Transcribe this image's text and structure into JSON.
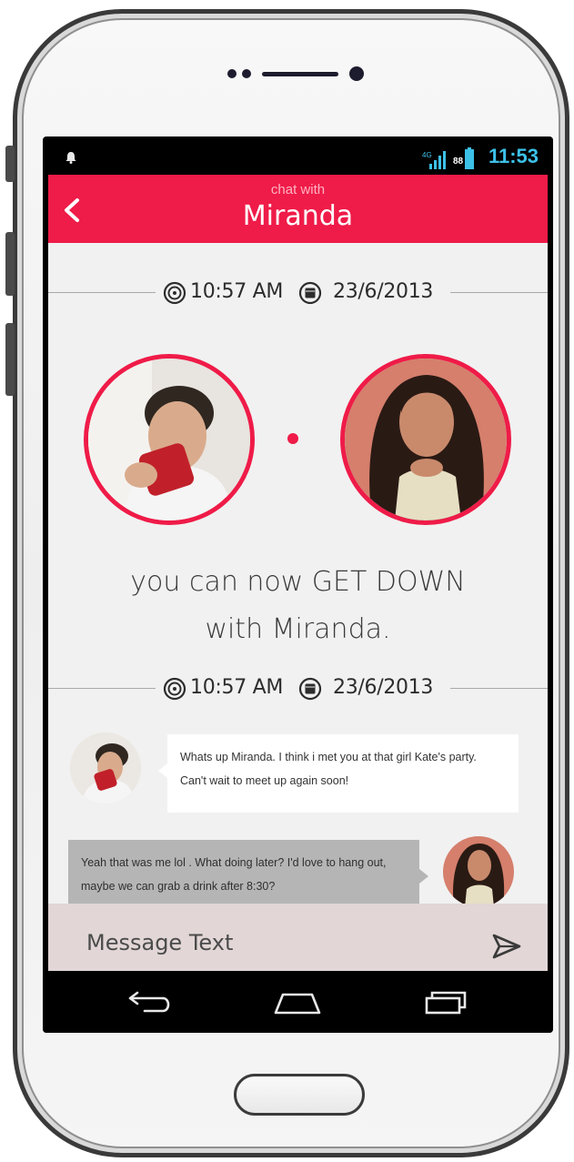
{
  "status_bar": {
    "time": "11:53",
    "network": "4G",
    "battery": "88"
  },
  "header": {
    "subtitle": "chat with",
    "title": "Miranda"
  },
  "match_timestamp": {
    "time": "10:57 AM",
    "date": "23/6/2013"
  },
  "match_message": {
    "line1": "you can now GET DOWN",
    "line2": "with Miranda."
  },
  "chat_timestamp": {
    "time": "10:57 AM",
    "date": "23/6/2013"
  },
  "messages": [
    {
      "from": "user",
      "text": "Whats up Miranda. I think i met you at that girl Kate's party. Can't wait to meet up again soon!"
    },
    {
      "from": "miranda",
      "text": "Yeah that was me lol . What doing later? I'd love to hang out, maybe we can grab a drink after 8:30?"
    }
  ],
  "composer": {
    "placeholder": "Message Text"
  },
  "colors": {
    "accent": "#ef1b48",
    "status_time": "#3cc1e8",
    "screen_bg": "#f1f1f1"
  }
}
